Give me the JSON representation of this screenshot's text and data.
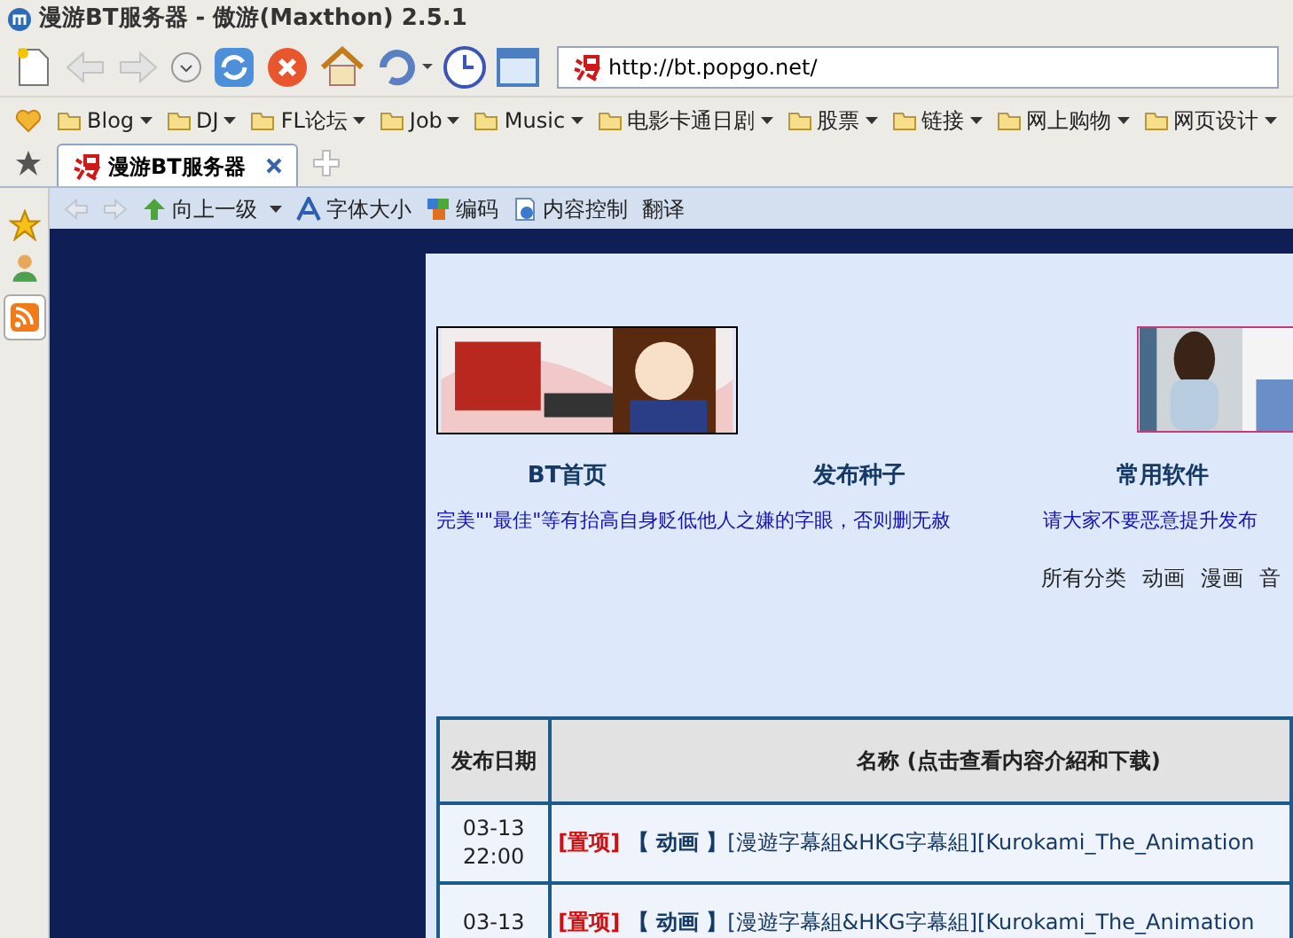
{
  "window": {
    "title": "漫游BT服务器 - 傲游(Maxthon) 2.5.1"
  },
  "address_bar": {
    "url": "http://bt.popgo.net/"
  },
  "bookmarks": [
    "Blog",
    "DJ",
    "FL论坛",
    "Job",
    "Music",
    "电影卡通日剧",
    "股票",
    "链接",
    "网上购物",
    "网页设计"
  ],
  "tabs": [
    {
      "label": "漫游BT服务器",
      "selected": true
    }
  ],
  "page_toolbar": [
    {
      "label": "向上一级",
      "kind": "up"
    },
    {
      "label": "字体大小",
      "kind": "font"
    },
    {
      "label": "编码",
      "kind": "encoding"
    },
    {
      "label": "内容控制",
      "kind": "content"
    },
    {
      "label": "翻译",
      "kind": "plain"
    }
  ],
  "page": {
    "nav": [
      "BT首页",
      "发布种子",
      "常用软件"
    ],
    "notices": [
      "完美\"\"最佳\"等有抬高自身贬低他人之嫌的字眼，否则删无赦",
      "请大家不要恶意提升发布"
    ],
    "categories": [
      "所有分类",
      "动画",
      "漫画",
      "音"
    ],
    "table": {
      "columns": [
        "发布日期",
        "名称 (点击查看内容介紹和下载)"
      ],
      "rows": [
        {
          "date": "03-13",
          "time": "22:00",
          "tag": "[置项]",
          "category": "【 动画 】",
          "title": "[漫遊字幕組&HKG字幕組][Kurokami_The_Animation"
        },
        {
          "date": "03-13",
          "tag": "[置项]",
          "category": "【 动画 】",
          "title": "[漫遊字幕組&HKG字幕組][Kurokami_The_Animation"
        }
      ]
    }
  }
}
